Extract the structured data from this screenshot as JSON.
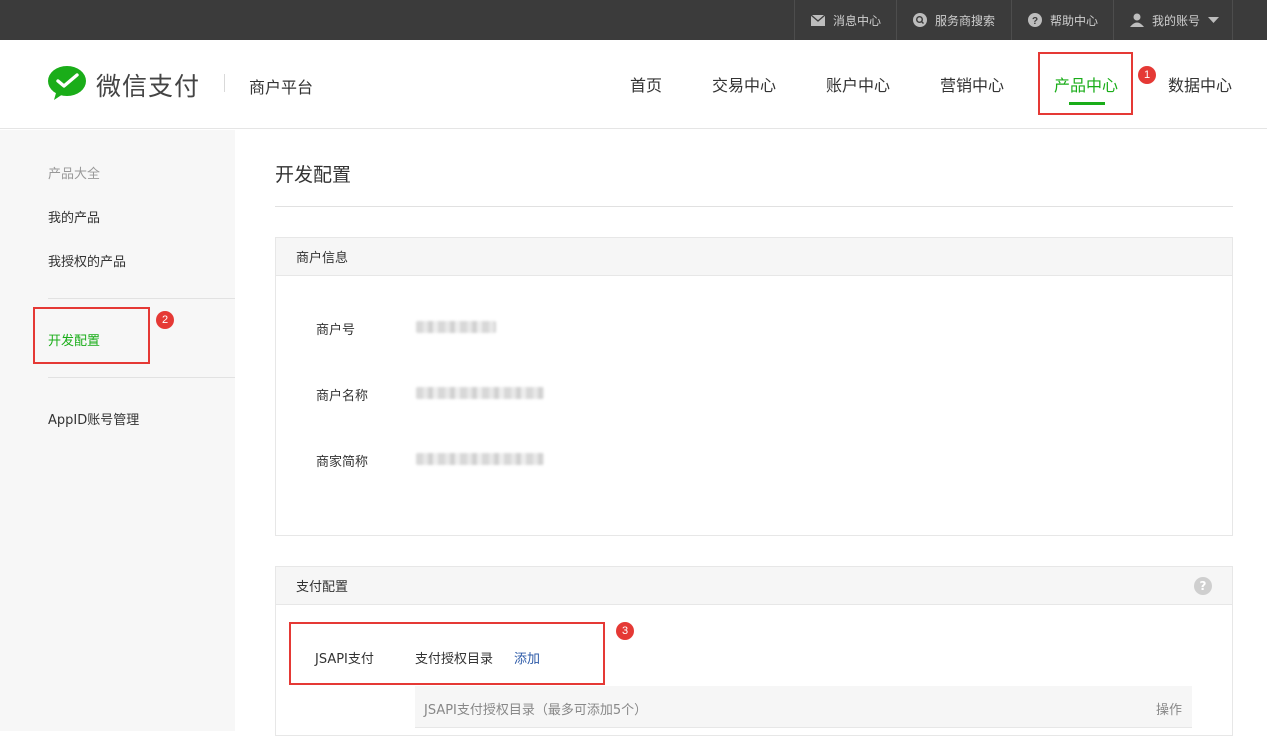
{
  "topbar": {
    "items": [
      {
        "label": "消息中心",
        "icon": "mail-icon"
      },
      {
        "label": "服务商搜索",
        "icon": "search-icon"
      },
      {
        "label": "帮助中心",
        "icon": "help-icon"
      },
      {
        "label": "我的账号",
        "icon": "user-icon"
      }
    ]
  },
  "header": {
    "logo_text": "微信支付",
    "platform": "商户平台",
    "nav": [
      "首页",
      "交易中心",
      "账户中心",
      "营销中心",
      "产品中心",
      "数据中心"
    ],
    "active_nav": "产品中心"
  },
  "annotations": [
    "1",
    "2",
    "3"
  ],
  "sidebar": {
    "section_title": "产品大全",
    "items": [
      "我的产品",
      "我授权的产品",
      "开发配置",
      "AppID账号管理"
    ],
    "active": "开发配置"
  },
  "main": {
    "title": "开发配置",
    "merchant_panel": {
      "title": "商户信息",
      "rows": [
        {
          "label": "商户号"
        },
        {
          "label": "商户名称"
        },
        {
          "label": "商家简称"
        }
      ]
    },
    "payment_panel": {
      "title": "支付配置",
      "help": "?",
      "jsapi_label": "JSAPI支付",
      "dir_label": "支付授权目录",
      "add_label": "添加",
      "table": {
        "col_dir": "JSAPI支付授权目录（最多可添加5个）",
        "col_ops": "操作"
      }
    }
  },
  "colors": {
    "brand_green": "#1aad19",
    "annotation_red": "#e53935",
    "link_blue": "#2e5ba8",
    "topbar_bg": "#3b3b3b"
  }
}
